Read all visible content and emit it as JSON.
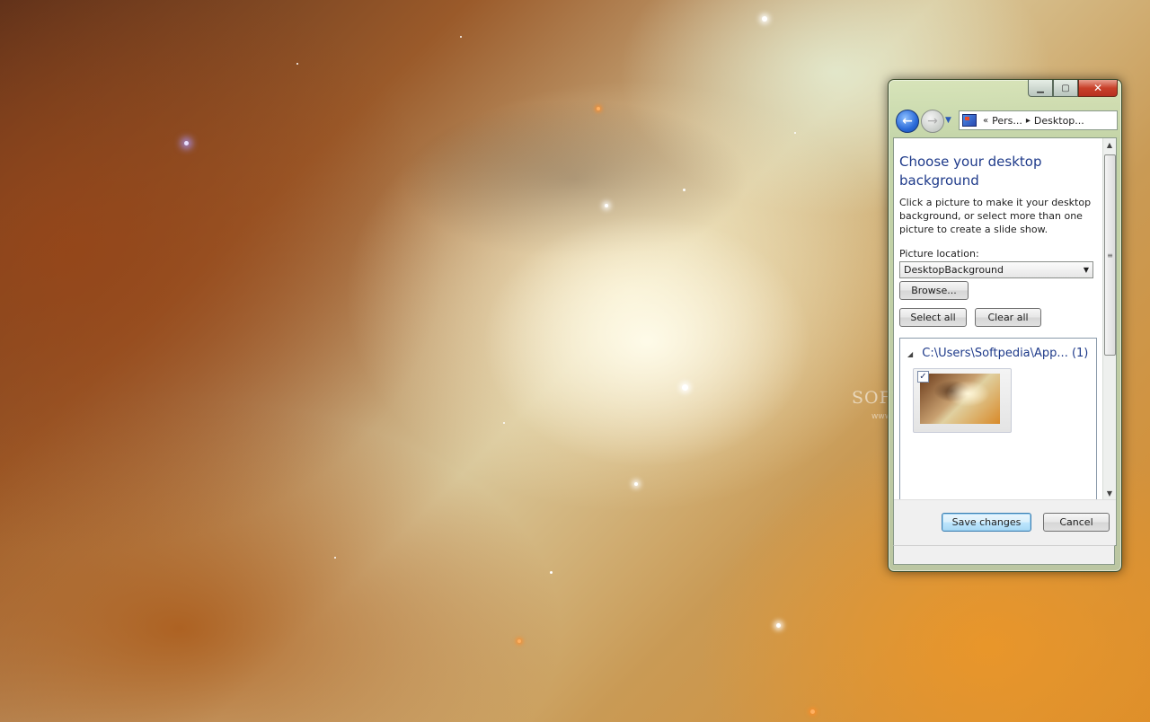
{
  "watermark": {
    "text": "SOFTPEDIA",
    "sub": "www.softpedia.com"
  },
  "window": {
    "caption_buttons": {
      "minimize": "▁",
      "maximize": "▢",
      "close": "✕"
    },
    "nav": {
      "back_icon": "back-arrow-icon",
      "forward_icon": "forward-arrow-icon",
      "address": {
        "icon": "control-panel-icon",
        "overflow": "«",
        "crumb1": "Pers...",
        "separator": "▸",
        "crumb2": "Desktop..."
      }
    },
    "content": {
      "title": "Choose your desktop background",
      "description": "Click a picture to make it your desktop background, or select more than one picture to create a slide show.",
      "picture_location_label": "Picture location:",
      "picture_location_value": "DesktopBackground",
      "browse_label": "Browse...",
      "select_all_label": "Select all",
      "clear_all_label": "Clear all",
      "group": {
        "path": "C:\\Users\\Softpedia\\App...",
        "count": "(1)",
        "expanded": true
      },
      "thumbnail": {
        "checked": true,
        "check_mark": "✓"
      }
    },
    "footer": {
      "save_label": "Save changes",
      "cancel_label": "Cancel"
    }
  },
  "colors": {
    "title_blue": "#1e3a8a",
    "glass_frame": "#c4d6aa",
    "close_red": "#c8402a"
  }
}
